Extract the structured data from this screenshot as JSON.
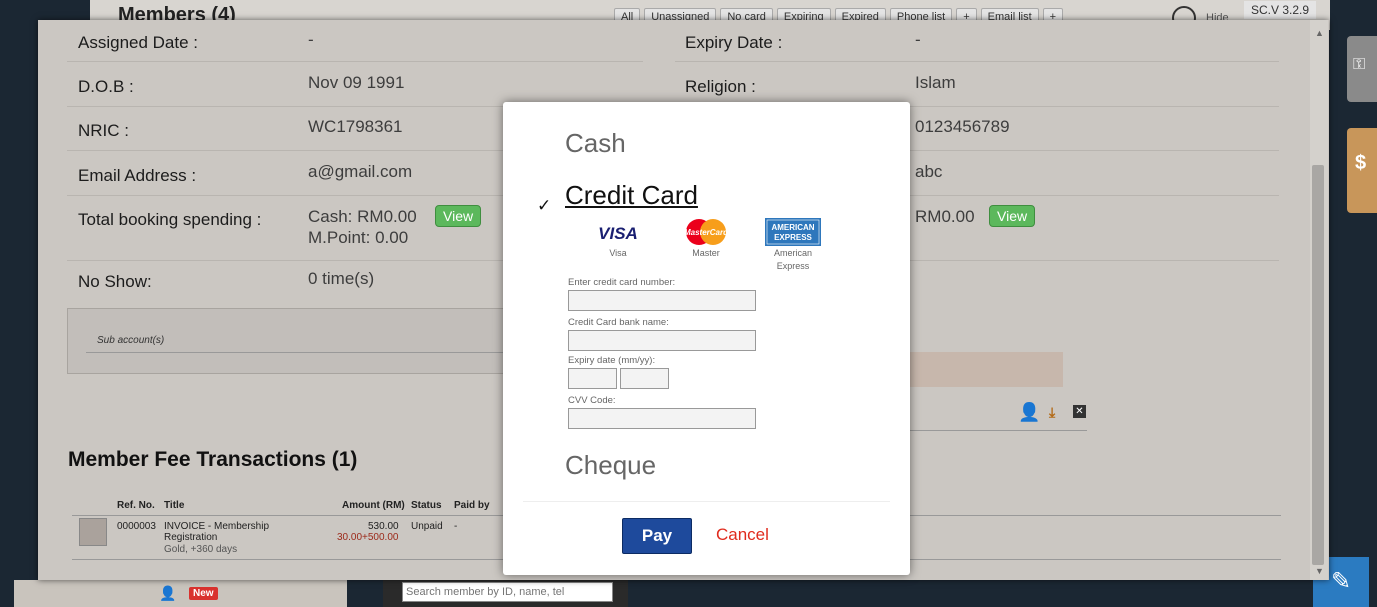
{
  "background": {
    "members_title": "Members (4)",
    "filters": [
      "All",
      "Unassigned",
      "No card",
      "Expiring",
      "Expired",
      "Phone list",
      "+",
      "Email list",
      "+"
    ],
    "hide_label": "Hide",
    "version": "SC.V 3.2.9",
    "new_badge": "New",
    "search_placeholder": "Search member by ID, name, tel"
  },
  "member": {
    "assigned_date_label": "Assigned Date :",
    "assigned_date_value": "-",
    "expiry_date_label": "Expiry Date :",
    "expiry_date_value": "-",
    "dob_label": "D.O.B :",
    "dob_value": "Nov 09 1991",
    "religion_label": "Religion :",
    "religion_value": "Islam",
    "nric_label": "NRIC :",
    "nric_value": "WC1798361",
    "contact_value": "0123456789",
    "email_label": "Email Address :",
    "email_value": "a@gmail.com",
    "mailing_value": "abc",
    "spending_label": "Total booking spending :",
    "spending_cash": "Cash: RM0.00",
    "spending_points": "M.Point: 0.00",
    "view_label": "View",
    "fee_value": "RM0.00",
    "noshow_label": "No Show:",
    "noshow_value": "0 time(s)",
    "sub_accounts_label": "Sub account(s)"
  },
  "transactions": {
    "title": "Member Fee Transactions (1)",
    "columns": [
      "Ref. No.",
      "Title",
      "Amount (RM)",
      "Status",
      "Paid by"
    ],
    "rows": [
      {
        "ref": "0000003",
        "title_line1": "INVOICE - Membership",
        "title_line2": "Registration",
        "title_line3": "Gold, +360 days",
        "amount": "530.00",
        "amount_breakdown": "30.00+500.00",
        "status": "Unpaid",
        "paid_by": "-"
      }
    ]
  },
  "payment": {
    "methods": {
      "cash": "Cash",
      "credit_card": "Credit Card",
      "cheque": "Cheque"
    },
    "selected_method": "credit_card",
    "cards": [
      {
        "name": "Visa",
        "logo_text": "VISA",
        "icon": "visa-logo"
      },
      {
        "name": "Master",
        "logo_text": "MasterCard",
        "icon": "mastercard-logo"
      },
      {
        "name": "American Express",
        "logo_text": "AMERICAN EXPRESS",
        "icon": "amex-logo"
      }
    ],
    "fields": {
      "card_number_label": "Enter credit card number:",
      "bank_name_label": "Credit Card bank name:",
      "expiry_label": "Expiry date (mm/yy):",
      "cvv_label": "CVV Code:"
    },
    "pay_label": "Pay",
    "cancel_label": "Cancel"
  }
}
